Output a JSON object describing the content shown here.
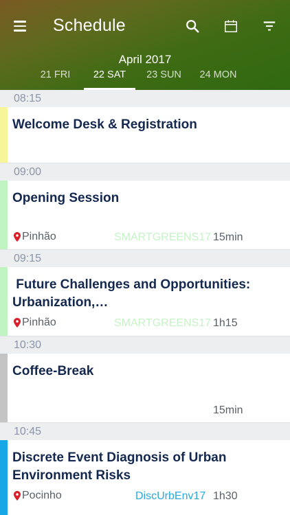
{
  "header": {
    "title": "Schedule",
    "month": "April 2017",
    "icons": {
      "menu": "menu-icon",
      "search": "search-icon",
      "calendar": "calendar-icon",
      "filter": "filter-icon"
    },
    "tabs": [
      {
        "label": "21 FRI",
        "active": false
      },
      {
        "label": "22 SAT",
        "active": true
      },
      {
        "label": "23 SUN",
        "active": false
      },
      {
        "label": "24 MON",
        "active": false
      }
    ]
  },
  "colors": {
    "smartgreens": "#c6f3c6",
    "discurbenv": "#29a9e0",
    "bar_yellow": "#f6f59a",
    "bar_green": "#bff3bf",
    "bar_gray": "#c4c4c4",
    "bar_blue": "#18a7e6"
  },
  "schedule": [
    {
      "time": "08:15",
      "title": "Welcome Desk & Registration",
      "location": "",
      "track": "",
      "duration": ""
    },
    {
      "time": "09:00",
      "title": "Opening Session",
      "location": "Pinhão",
      "track": "SMARTGREENS17",
      "duration": "15min"
    },
    {
      "time": "09:15",
      "title": " Future Challenges and Opportunities: Urbanization,…",
      "location": "Pinhão",
      "track": "SMARTGREENS17",
      "duration": "1h15"
    },
    {
      "time": "10:30",
      "title": "Coffee-Break",
      "location": "",
      "track": "",
      "duration": "15min"
    },
    {
      "time": "10:45",
      "title": "Discrete Event Diagnosis of Urban Environment Risks",
      "location": "Pocinho",
      "track": "DiscUrbEnv17",
      "duration": "1h30"
    }
  ]
}
